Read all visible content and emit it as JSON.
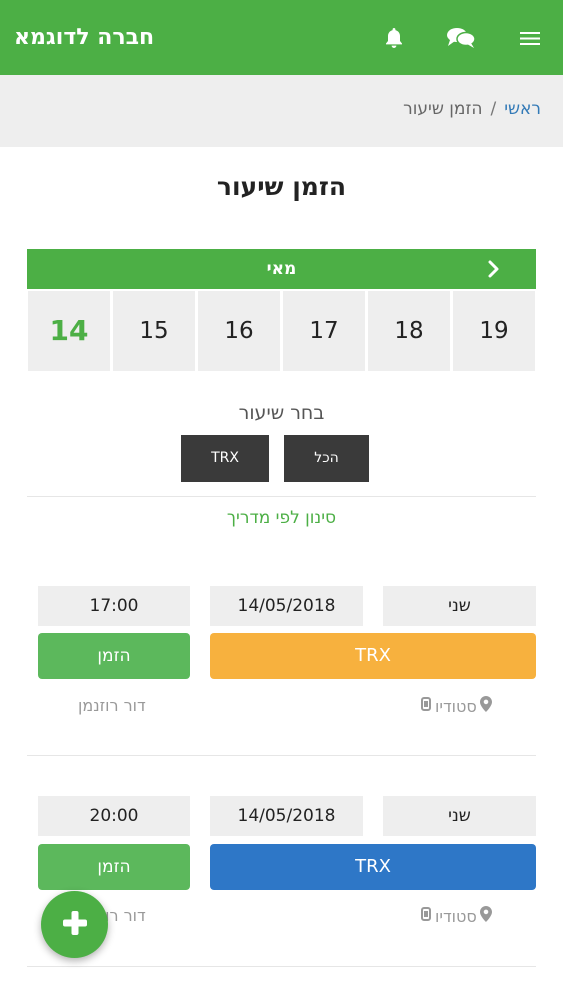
{
  "header": {
    "brand": "חברה לדוגמא",
    "icons": [
      "bell-icon",
      "chat-icon",
      "menu-icon"
    ],
    "accent": "#4caf45"
  },
  "breadcrumb": {
    "home": "ראשי",
    "separator": "/",
    "current": "הזמן שיעור"
  },
  "page_title": "הזמן שיעור",
  "calendar": {
    "month": "מאי",
    "days": [
      "14",
      "15",
      "16",
      "17",
      "18",
      "19"
    ],
    "selected_day": "14"
  },
  "class_filter": {
    "label": "בחר שיעור",
    "all_label": "הכל",
    "trx_label": "TRX"
  },
  "trainer_filter": "סינון לפי מדריך",
  "sessions": [
    {
      "day": "שני",
      "date": "14/05/2018",
      "time": "17:00",
      "class_name": "TRX",
      "class_color": "#f7b13e",
      "book_label": "הזמן",
      "location": "סטודיו",
      "trainer": "דור רוזנמן"
    },
    {
      "day": "שני",
      "date": "14/05/2018",
      "time": "20:00",
      "class_name": "TRX",
      "class_color": "#2e77c7",
      "book_label": "הזמן",
      "location": "סטודיו",
      "trainer": "דור רוזנמן"
    }
  ]
}
